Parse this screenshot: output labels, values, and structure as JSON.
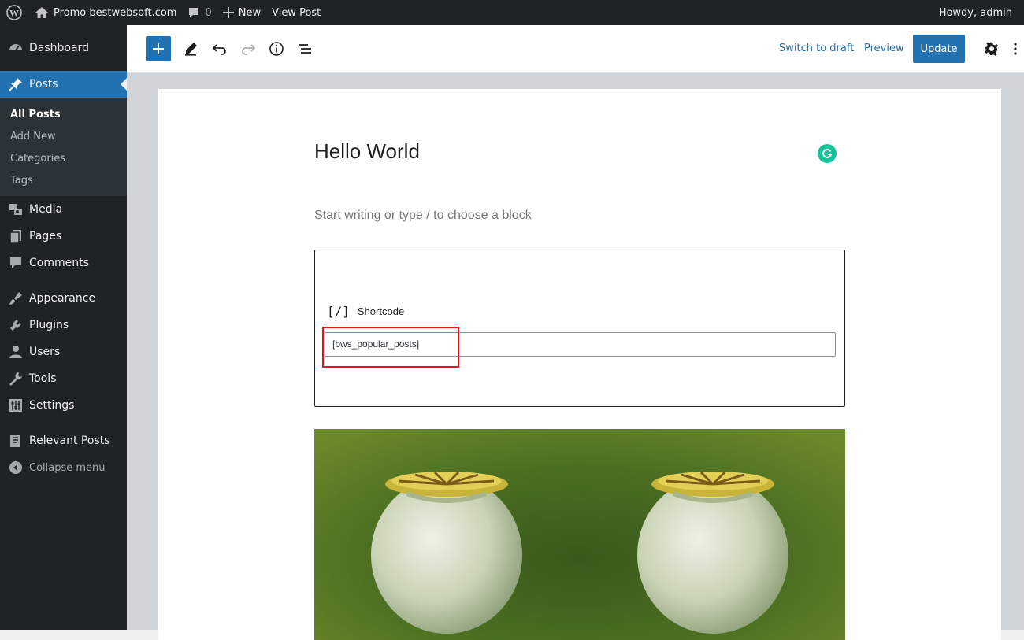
{
  "adminbar": {
    "site_name": "Promo bestwebsoft.com",
    "comments_count": "0",
    "new_label": "New",
    "view_post_label": "View Post",
    "howdy": "Howdy, admin"
  },
  "sidebar": {
    "dashboard": "Dashboard",
    "posts": "Posts",
    "posts_submenu": [
      "All Posts",
      "Add New",
      "Categories",
      "Tags"
    ],
    "media": "Media",
    "pages": "Pages",
    "comments": "Comments",
    "appearance": "Appearance",
    "plugins": "Plugins",
    "users": "Users",
    "tools": "Tools",
    "settings": "Settings",
    "relevant_posts": "Relevant Posts",
    "collapse": "Collapse menu"
  },
  "toolbar": {
    "switch_to_draft": "Switch to draft",
    "preview": "Preview",
    "update": "Update"
  },
  "post": {
    "title": "Hello World",
    "placeholder": "Start writing or type / to choose a block",
    "shortcode_icon": "[/]",
    "shortcode_label": "Shortcode",
    "shortcode_value": "[bws_popular_posts]"
  },
  "colors": {
    "admin_dark": "#1d2327",
    "accent": "#2271b1",
    "highlight": "#e3141c",
    "grammarly": "#15c39a"
  }
}
